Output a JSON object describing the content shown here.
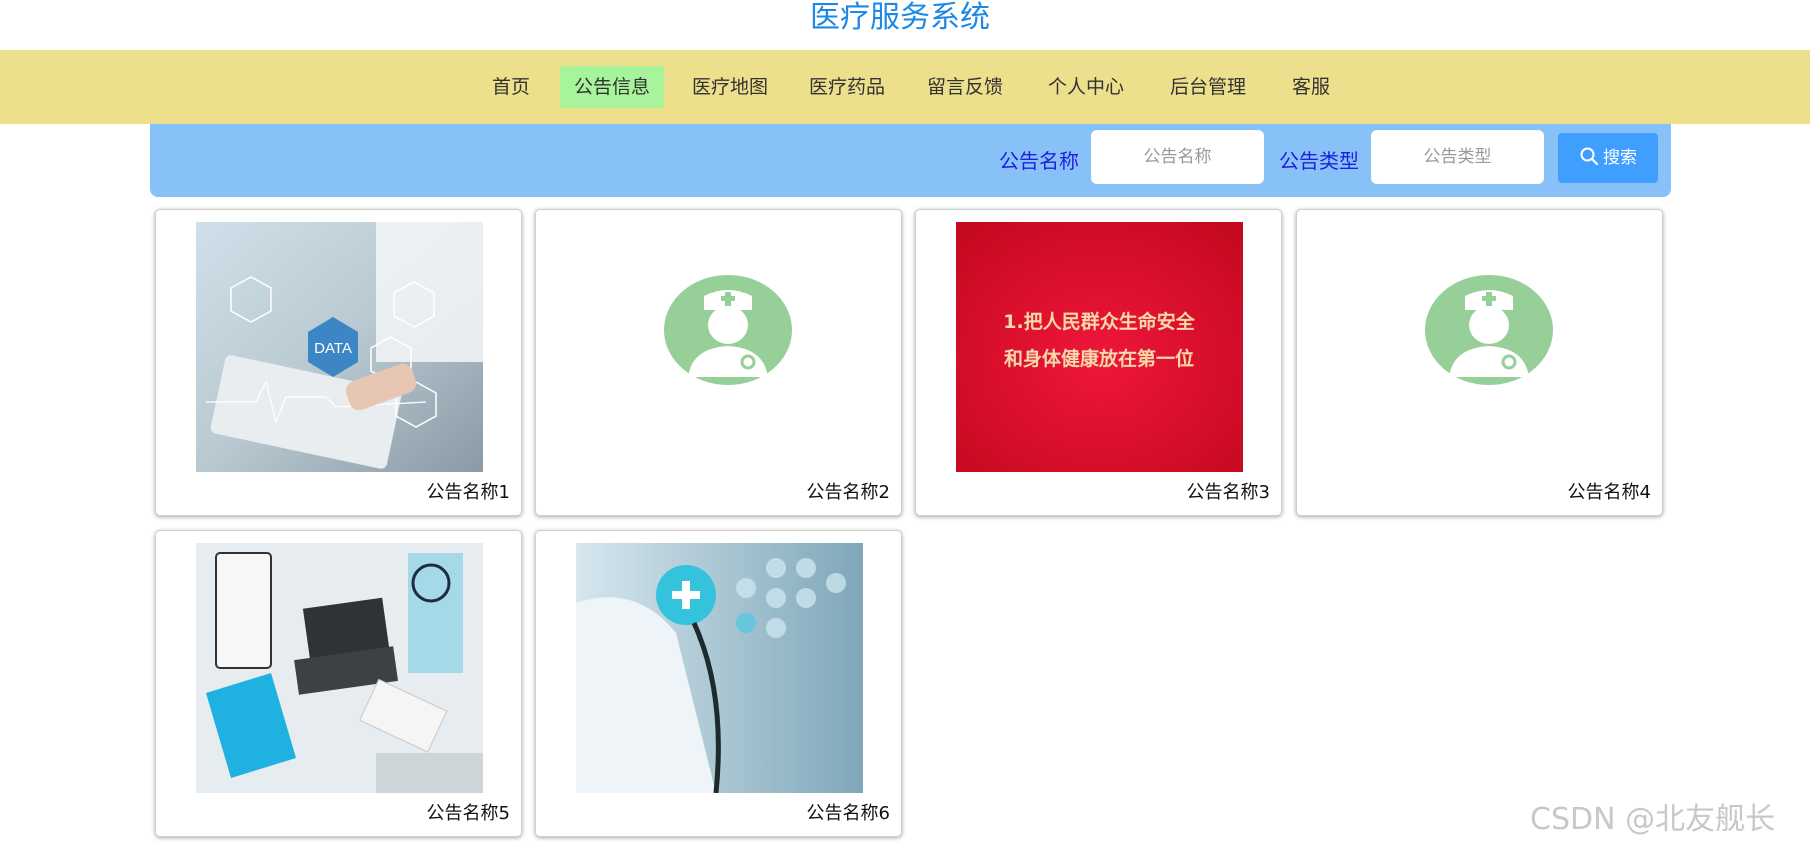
{
  "site": {
    "title": "医疗服务系统"
  },
  "nav": {
    "items": [
      {
        "label": "首页"
      },
      {
        "label": "公告信息",
        "active": true
      },
      {
        "label": "医疗地图"
      },
      {
        "label": "医疗药品"
      },
      {
        "label": "留言反馈"
      },
      {
        "label": "个人中心"
      },
      {
        "label": "后台管理"
      },
      {
        "label": "客服"
      }
    ]
  },
  "search": {
    "name_label": "公告名称",
    "name_placeholder": "公告名称",
    "name_value": "",
    "type_label": "公告类型",
    "type_placeholder": "公告类型",
    "type_value": "",
    "button_label": "搜索",
    "button_icon": "search-icon"
  },
  "cards": [
    {
      "title": "公告名称1",
      "image": "medical-data-photo"
    },
    {
      "title": "公告名称2",
      "image": "doctor-avatar-placeholder"
    },
    {
      "title": "公告名称3",
      "image": "red-slogan-banner",
      "image_text": [
        "1.把人民群众生命安全",
        "和身体健康放在第一位"
      ]
    },
    {
      "title": "公告名称4",
      "image": "doctor-avatar-placeholder"
    },
    {
      "title": "公告名称5",
      "image": "desk-laptop-stethoscope-photo"
    },
    {
      "title": "公告名称6",
      "image": "doctor-stethoscope-photo"
    }
  ],
  "colors": {
    "title": "#1e88e5",
    "nav_bg": "#ede08c",
    "nav_active": "#a7f49b",
    "search_bg": "#87c1f8",
    "search_label": "#1f1fe0",
    "button": "#409eff"
  },
  "watermark": "CSDN @北友舰长"
}
